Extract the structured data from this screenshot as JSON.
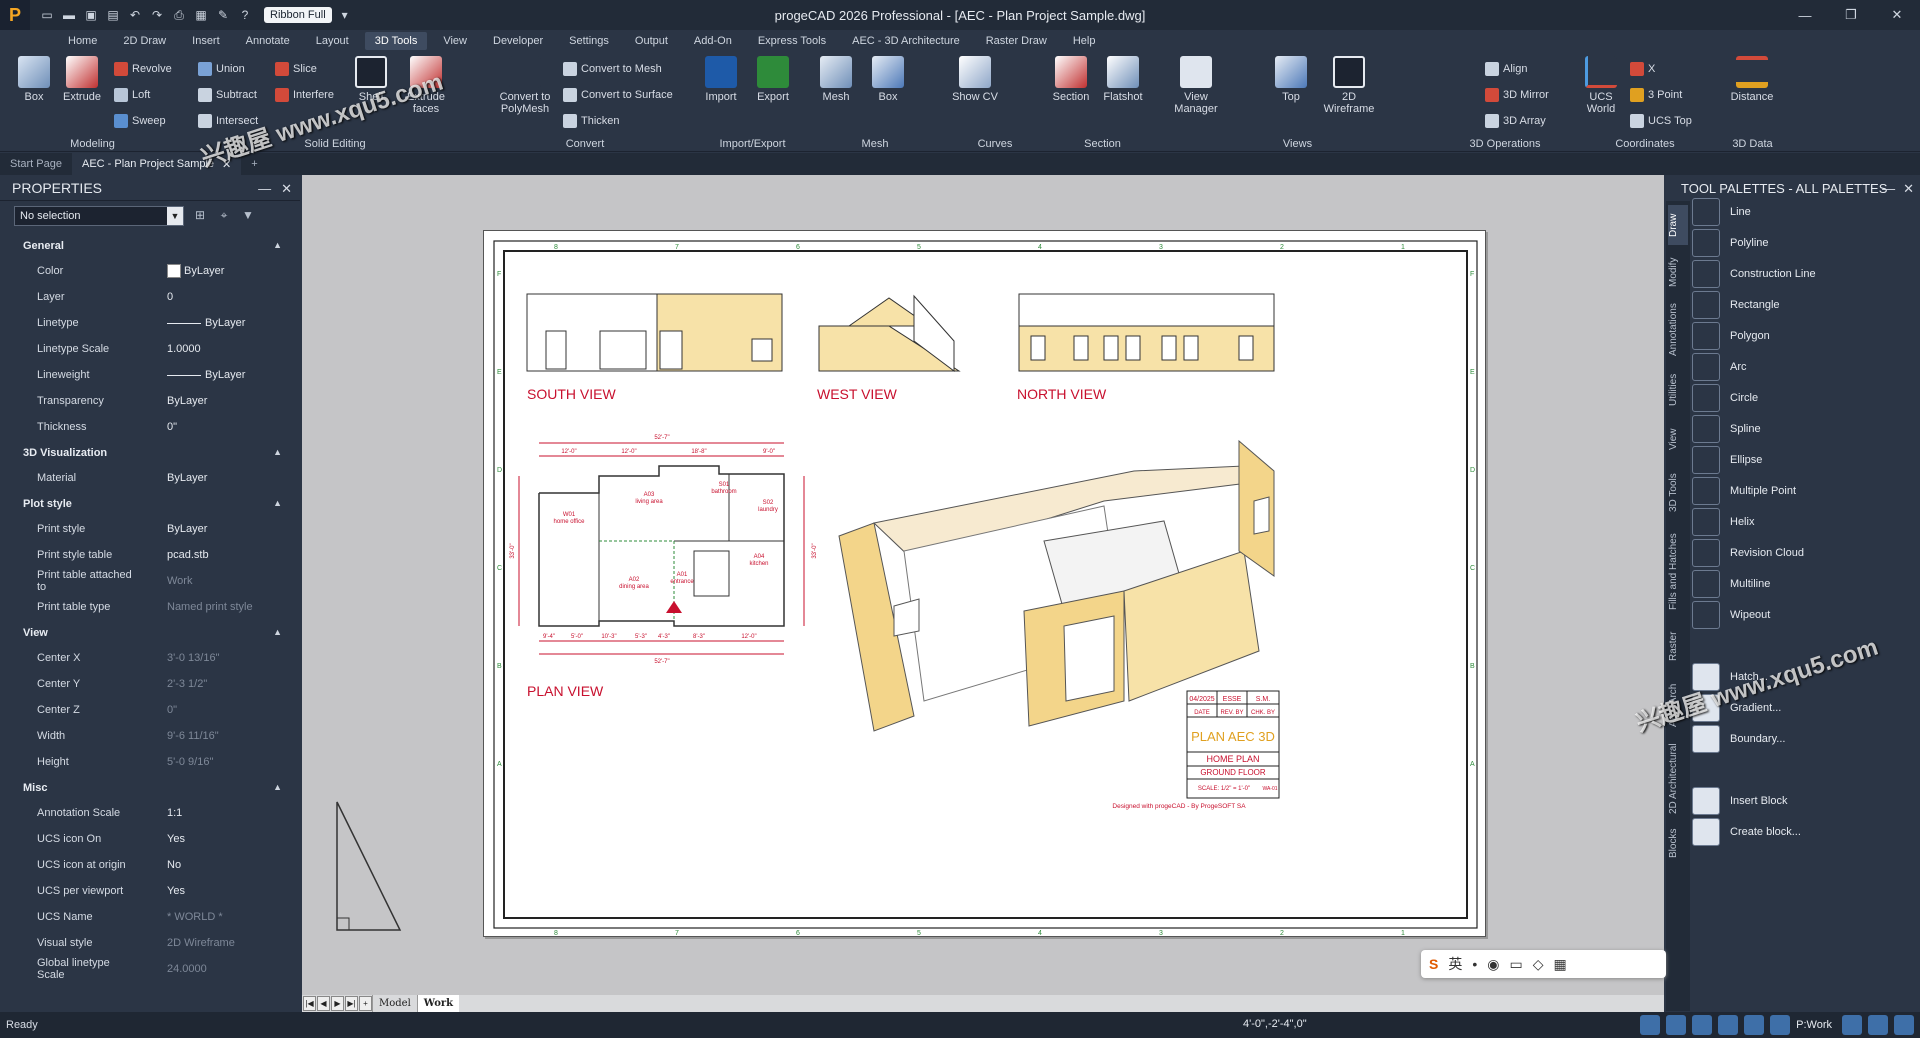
{
  "app": {
    "title": "progeCAD 2026 Professional - [AEC - Plan Project Sample.dwg]",
    "ribbon_mode": "Ribbon Full"
  },
  "tabs": [
    "Home",
    "2D Draw",
    "Insert",
    "Annotate",
    "Layout",
    "3D Tools",
    "View",
    "Developer",
    "Settings",
    "Output",
    "Add-On",
    "Express Tools",
    "AEC - 3D Architecture",
    "Raster Draw",
    "Help"
  ],
  "active_tab": "3D Tools",
  "ribbon": {
    "modeling": {
      "label": "Modeling",
      "box": "Box",
      "extrude": "Extrude",
      "revolve": "Revolve",
      "loft": "Loft",
      "sweep": "Sweep"
    },
    "solid_editing": {
      "label": "Solid Editing",
      "union": "Union",
      "subtract": "Subtract",
      "intersect": "Intersect",
      "slice": "Slice",
      "interfere": "Interfere",
      "shell": "Shell",
      "extrude_faces": "Extrude faces"
    },
    "convert": {
      "label": "Convert",
      "to_polymesh": "Convert to PolyMesh",
      "to_mesh": "Convert to Mesh",
      "to_surface": "Convert to Surface",
      "thicken": "Thicken"
    },
    "import_export": {
      "label": "Import/Export",
      "import": "Import",
      "export": "Export"
    },
    "mesh": {
      "label": "Mesh",
      "mesh": "Mesh",
      "box": "Box"
    },
    "curves": {
      "label": "Curves",
      "show_cv": "Show CV"
    },
    "section": {
      "label": "Section",
      "section": "Section",
      "flatshot": "Flatshot"
    },
    "views": {
      "label": "Views",
      "view_manager": "View Manager",
      "top": "Top",
      "wireframe": "2D Wireframe"
    },
    "ops3d": {
      "label": "3D Operations",
      "align": "Align",
      "mirror": "3D Mirror",
      "array": "3D Array"
    },
    "coordinates": {
      "label": "Coordinates",
      "ucs_world": "UCS World",
      "x": "X",
      "three_point": "3 Point",
      "ucs_top": "UCS Top"
    },
    "data3d": {
      "label": "3D Data",
      "distance": "Distance"
    }
  },
  "doc_tabs": [
    "Start Page",
    "AEC - Plan Project Sample"
  ],
  "properties": {
    "title": "PROPERTIES",
    "selection": "No selection",
    "sections": [
      {
        "name": "General",
        "rows": [
          [
            "Color",
            "ByLayer"
          ],
          [
            "Layer",
            "0"
          ],
          [
            "Linetype",
            "ByLayer"
          ],
          [
            "Linetype Scale",
            "1.0000"
          ],
          [
            "Lineweight",
            "ByLayer"
          ],
          [
            "Transparency",
            "ByLayer"
          ],
          [
            "Thickness",
            "0\""
          ]
        ]
      },
      {
        "name": "3D Visualization",
        "rows": [
          [
            "Material",
            "ByLayer"
          ]
        ]
      },
      {
        "name": "Plot style",
        "rows": [
          [
            "Print style",
            "ByLayer"
          ],
          [
            "Print style table",
            "pcad.stb"
          ],
          [
            "Print table attached to",
            "Work"
          ],
          [
            "Print table type",
            "Named print style"
          ]
        ]
      },
      {
        "name": "View",
        "rows": [
          [
            "Center X",
            "3'-0 13/16\""
          ],
          [
            "Center Y",
            "2'-3 1/2\""
          ],
          [
            "Center Z",
            "0\""
          ],
          [
            "Width",
            "9'-6 11/16\""
          ],
          [
            "Height",
            "5'-0 9/16\""
          ]
        ]
      },
      {
        "name": "Misc",
        "rows": [
          [
            "Annotation Scale",
            "1:1"
          ],
          [
            "UCS icon On",
            "Yes"
          ],
          [
            "UCS icon at origin",
            "No"
          ],
          [
            "UCS per viewport",
            "Yes"
          ],
          [
            "UCS Name",
            "* WORLD *"
          ],
          [
            "Visual style",
            "2D Wireframe"
          ],
          [
            "Global linetype Scale",
            "24.0000"
          ]
        ]
      }
    ]
  },
  "drawing": {
    "south_view": "SOUTH VIEW",
    "west_view": "WEST VIEW",
    "north_view": "NORTH VIEW",
    "plan_view": "PLAN VIEW",
    "rooms": {
      "w01": "W01",
      "w01_name": "home office",
      "a03": "A03",
      "a03_name": "living area",
      "s01": "S01",
      "s01_name": "bathroom",
      "s02": "S02",
      "s02_name": "laundry",
      "a04": "A04",
      "a04_name": "kitchen",
      "a02": "A02",
      "a02_name": "dining area",
      "a01": "A01",
      "a01_name": "entrance"
    },
    "dims": {
      "top_overall": "52'-7\"",
      "d1": "12'-0\"",
      "d2": "12'-0\"",
      "d3": "18'-8\"",
      "d4": "9'-0\"",
      "bottom_overall": "52'-7\"",
      "b1": "9'-4\"",
      "b2": "5'-0\"",
      "b3": "10'-3\"",
      "b4": "5'-3\"",
      "b5": "4'-3\"",
      "b6": "8'-3\"",
      "b7": "12'-0\"",
      "left": "33'-0\"",
      "right": "33'-0\""
    },
    "grid_top": [
      "8",
      "7",
      "6",
      "5",
      "4",
      "3",
      "2",
      "1"
    ],
    "grid_side": [
      "F",
      "E",
      "D",
      "C",
      "B",
      "A"
    ],
    "title_block": {
      "date": "04/2025",
      "drawn": "ESSE",
      "checked": "S.M.",
      "h_date": "DATE",
      "h_rev": "REV. BY",
      "h_chk": "CHK. BY",
      "title": "PLAN AEC 3D",
      "sub1": "HOME PLAN",
      "sub2": "GROUND FLOOR",
      "scale": "SCALE: 1/2\" = 1'-0\"",
      "sheet": "WA-01",
      "designed": "Designed with progeCAD - By ProgeSOFT SA"
    }
  },
  "layout_tabs": [
    "Model",
    "Work"
  ],
  "tool_palette": {
    "title": "TOOL PALETTES - ALL PALETTES",
    "vtabs": [
      "Draw",
      "Modify",
      "Annotations",
      "Utilities",
      "View",
      "3D Tools",
      "Fills and Hatches",
      "Raster",
      "AEC Arch",
      "2D Architectural",
      "Blocks"
    ],
    "tools": [
      "Line",
      "Polyline",
      "Construction Line",
      "Rectangle",
      "Polygon",
      "Arc",
      "Circle",
      "Spline",
      "Ellipse",
      "Multiple Point",
      "Helix",
      "Revision Cloud",
      "Multiline",
      "Wipeout",
      "Hatch...",
      "Gradient...",
      "Boundary...",
      "Insert Block",
      "Create block..."
    ]
  },
  "status": {
    "text": "Ready",
    "coords": "4'-0\",-2'-4\",0\"",
    "workspace": "P:Work"
  },
  "watermark": "兴趣屋 www.xqu5.com",
  "ime_label": "英"
}
